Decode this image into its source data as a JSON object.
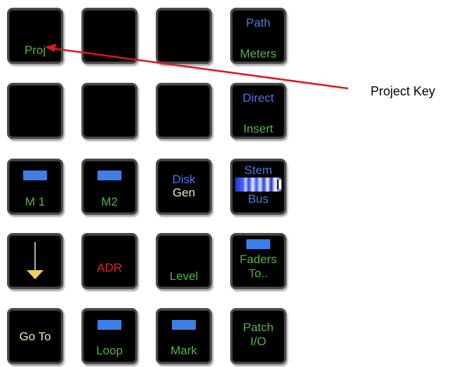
{
  "keys": {
    "proj": "Proj",
    "path": "Path",
    "meters": "Meters",
    "direct": "Direct",
    "insert": "Insert",
    "m1": "M 1",
    "m2": "M2",
    "disk": "Disk",
    "gen": "Gen",
    "stem": "Stem",
    "bus": "Bus",
    "adr": "ADR",
    "level": "Level",
    "faders": "Faders",
    "to": "To..",
    "goto": "Go To",
    "loop": "Loop",
    "mark": "Mark",
    "patch": "Patch",
    "io": "I/O"
  },
  "annotation": {
    "label": "Project Key"
  },
  "colors": {
    "key_bg": "#000000",
    "green_label": "#57b346",
    "blue_label": "#4b78e8",
    "red_label": "#d8262b",
    "cream_label": "#f2e6bd",
    "indicator_bar": "#3f7ee8",
    "arrow": "#e0161b"
  }
}
